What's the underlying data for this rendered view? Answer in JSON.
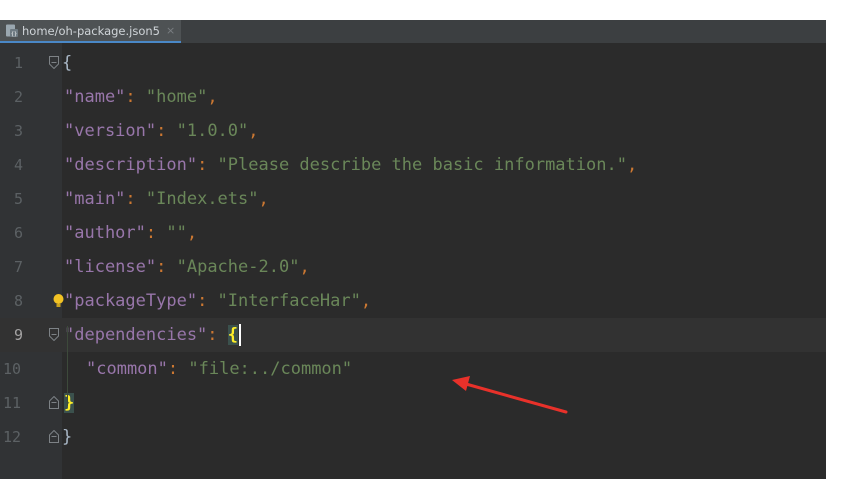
{
  "tab": {
    "label": "home/oh-package.json5",
    "close": "×"
  },
  "current_line": 9,
  "lines": [
    {
      "num": "1",
      "tokens": [
        {
          "t": "brace",
          "v": "{"
        }
      ]
    },
    {
      "num": "2",
      "tokens": [
        {
          "t": "key",
          "v": "\"name\""
        },
        {
          "t": "punc",
          "v": ": "
        },
        {
          "t": "str",
          "v": "\"home\""
        },
        {
          "t": "punc",
          "v": ","
        }
      ]
    },
    {
      "num": "3",
      "tokens": [
        {
          "t": "key",
          "v": "\"version\""
        },
        {
          "t": "punc",
          "v": ": "
        },
        {
          "t": "str",
          "v": "\"1.0.0\""
        },
        {
          "t": "punc",
          "v": ","
        }
      ]
    },
    {
      "num": "4",
      "tokens": [
        {
          "t": "key",
          "v": "\"description\""
        },
        {
          "t": "punc",
          "v": ": "
        },
        {
          "t": "str",
          "v": "\"Please describe the basic information.\""
        },
        {
          "t": "punc",
          "v": ","
        }
      ]
    },
    {
      "num": "5",
      "tokens": [
        {
          "t": "key",
          "v": "\"main\""
        },
        {
          "t": "punc",
          "v": ": "
        },
        {
          "t": "str",
          "v": "\"Index.ets\""
        },
        {
          "t": "punc",
          "v": ","
        }
      ]
    },
    {
      "num": "6",
      "tokens": [
        {
          "t": "key",
          "v": "\"author\""
        },
        {
          "t": "punc",
          "v": ": "
        },
        {
          "t": "str",
          "v": "\"\""
        },
        {
          "t": "punc",
          "v": ","
        }
      ]
    },
    {
      "num": "7",
      "tokens": [
        {
          "t": "key",
          "v": "\"license\""
        },
        {
          "t": "punc",
          "v": ": "
        },
        {
          "t": "str",
          "v": "\"Apache-2.0\""
        },
        {
          "t": "punc",
          "v": ","
        }
      ]
    },
    {
      "num": "8",
      "tokens": [
        {
          "t": "key",
          "v": "\"packageType\""
        },
        {
          "t": "punc",
          "v": ": "
        },
        {
          "t": "str",
          "v": "\"InterfaceHar\""
        },
        {
          "t": "punc",
          "v": ","
        }
      ]
    },
    {
      "num": "9",
      "tokens": [
        {
          "t": "key",
          "v": "\"dependencies\""
        },
        {
          "t": "punc",
          "v": ": "
        },
        {
          "t": "brace-hl",
          "v": "{"
        }
      ]
    },
    {
      "num": "10",
      "tokens": [
        {
          "t": "key",
          "v": "\"common\""
        },
        {
          "t": "punc",
          "v": ": "
        },
        {
          "t": "str",
          "v": "\"file:../common\""
        }
      ]
    },
    {
      "num": "11",
      "tokens": [
        {
          "t": "brace-hl",
          "v": "}"
        }
      ]
    },
    {
      "num": "12",
      "tokens": [
        {
          "t": "brace",
          "v": "}"
        }
      ]
    }
  ],
  "colors": {
    "editor_bg": "#2b2b2b",
    "key": "#9876aa",
    "string": "#6a8759",
    "punctuation": "#cc7832",
    "brace_match": "#ffef28",
    "annotation_arrow": "#e8312a"
  },
  "icons": {
    "tab_file": "json-file-icon",
    "line8_gutter": "lightbulb-icon",
    "fold_markers": "fold-marker-icon"
  }
}
